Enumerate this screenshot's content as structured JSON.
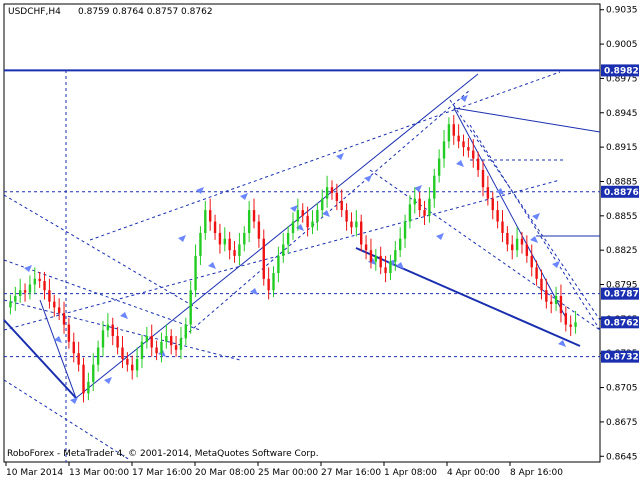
{
  "header": {
    "symbol": "USDCHF,H4",
    "ohlc": "0.8759 0.8764 0.8757 0.8762"
  },
  "footer": {
    "copyright": "RoboForex - MetaTrader 4, © 2001-2014, MetaQuotes Software Corp."
  },
  "colors": {
    "bull": "#22cc22",
    "bear": "#ee1111",
    "line": "#1a2fb0",
    "axis": "#000000",
    "marker": "#6b86ff",
    "label_bg": "#1a2fb0"
  },
  "chart_data": {
    "type": "candlestick",
    "ylim": [
      0.864,
      0.904
    ],
    "y_ticks": [
      0.9035,
      0.9005,
      0.8975,
      0.8945,
      0.8915,
      0.8885,
      0.8855,
      0.8825,
      0.8795,
      0.8765,
      0.8735,
      0.8705,
      0.8675,
      0.8645
    ],
    "x_ticks": [
      "10 Mar 2014",
      "13 Mar 00:00",
      "17 Mar 16:00",
      "20 Mar 08:00",
      "25 Mar 00:00",
      "27 Mar 16:00",
      "1 Apr 08:00",
      "4 Apr 00:00",
      "8 Apr 16:00"
    ],
    "price_labels": [
      {
        "value": 0.8982,
        "text": "0.8982"
      },
      {
        "value": 0.8876,
        "text": "0.8876"
      },
      {
        "value": 0.8787,
        "text": "0.8787"
      },
      {
        "value": 0.8762,
        "text": "0.8762"
      },
      {
        "value": 0.8732,
        "text": "0.8732"
      }
    ],
    "close_path": [
      0.878,
      0.8785,
      0.879,
      0.8788,
      0.8795,
      0.88,
      0.8798,
      0.879,
      0.878,
      0.8775,
      0.877,
      0.876,
      0.8745,
      0.8735,
      0.8725,
      0.87,
      0.871,
      0.8725,
      0.874,
      0.8755,
      0.876,
      0.875,
      0.874,
      0.873,
      0.8725,
      0.872,
      0.873,
      0.8745,
      0.875,
      0.874,
      0.8735,
      0.8745,
      0.875,
      0.8742,
      0.8738,
      0.8748,
      0.876,
      0.879,
      0.882,
      0.884,
      0.886,
      0.885,
      0.884,
      0.883,
      0.8835,
      0.8825,
      0.882,
      0.883,
      0.884,
      0.886,
      0.885,
      0.8835,
      0.88,
      0.879,
      0.8805,
      0.882,
      0.883,
      0.884,
      0.885,
      0.886,
      0.8855,
      0.8845,
      0.885,
      0.886,
      0.887,
      0.888,
      0.8875,
      0.8868,
      0.886,
      0.885,
      0.8845,
      0.885,
      0.883,
      0.8825,
      0.8815,
      0.882,
      0.881,
      0.8805,
      0.8815,
      0.8825,
      0.8835,
      0.885,
      0.8865,
      0.887,
      0.886,
      0.8855,
      0.887,
      0.889,
      0.8905,
      0.892,
      0.8935,
      0.8925,
      0.892,
      0.8915,
      0.8912,
      0.8905,
      0.8895,
      0.888,
      0.887,
      0.886,
      0.885,
      0.884,
      0.883,
      0.8825,
      0.8835,
      0.883,
      0.882,
      0.881,
      0.88,
      0.879,
      0.878,
      0.8778,
      0.8785,
      0.877,
      0.876,
      0.8758,
      0.8762
    ]
  }
}
